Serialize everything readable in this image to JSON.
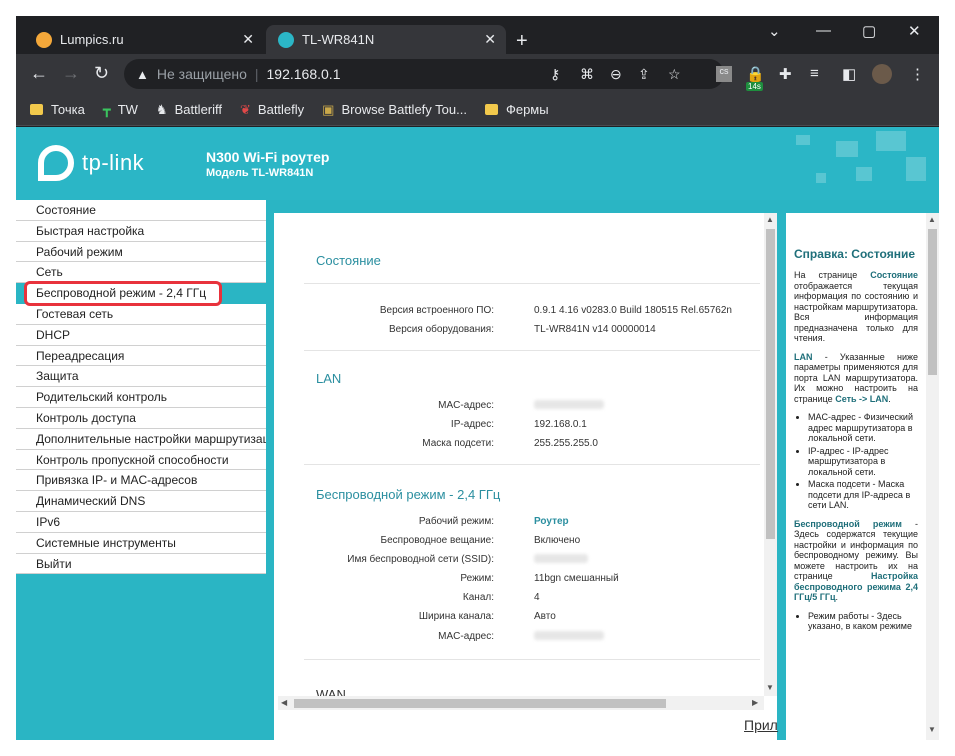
{
  "browser": {
    "tabs": [
      {
        "label": "Lumpics.ru",
        "close": "✕"
      },
      {
        "label": "TL-WR841N",
        "close": "✕"
      }
    ],
    "new_tab": "+",
    "window_controls": {
      "dropdown": "⌄",
      "minimize": "—",
      "maximize": "▢",
      "close": "✕"
    },
    "toolbar": {
      "back": "←",
      "forward": "→",
      "reload": "↻"
    },
    "omnibox": {
      "security_text": "Не защищено",
      "separator": "|",
      "url": "192.168.0.1"
    },
    "extension_badge": "14s",
    "bookmarks": [
      {
        "label": "Точка",
        "icon": "folder-icon"
      },
      {
        "label": "TW",
        "icon": "tw-icon"
      },
      {
        "label": "Battleriff",
        "icon": "battleriff-icon"
      },
      {
        "label": "Battlefly",
        "icon": "battlefly-icon"
      },
      {
        "label": "Browse Battlefy Tou...",
        "icon": "battlefy-icon"
      },
      {
        "label": "Фермы",
        "icon": "folder-icon"
      }
    ]
  },
  "router": {
    "logo_text": "tp-link",
    "product_title": "N300 Wi-Fi роутер",
    "product_model": "Модель TL-WR841N",
    "menu": [
      "Состояние",
      "Быстрая настройка",
      "Рабочий режим",
      "Сеть",
      "Беспроводной режим - 2,4 ГГц",
      "Гостевая сеть",
      "DHCP",
      "Переадресация",
      "Защита",
      "Родительский контроль",
      "Контроль доступа",
      "Дополнительные настройки маршрутизации",
      "Контроль пропускной способности",
      "Привязка IP- и MAC-адресов",
      "Динамический DNS",
      "IPv6",
      "Системные инструменты",
      "Выйти"
    ],
    "status": {
      "title": "Состояние",
      "firmware_label": "Версия встроенного ПО:",
      "firmware_value": "0.9.1 4.16 v0283.0 Build 180515 Rel.65762n",
      "hardware_label": "Версия оборудования:",
      "hardware_value": "TL-WR841N v14 00000014"
    },
    "lan": {
      "title": "LAN",
      "mac_label": "MAC-адрес:",
      "ip_label": "IP-адрес:",
      "ip_value": "192.168.0.1",
      "mask_label": "Маска подсети:",
      "mask_value": "255.255.255.0"
    },
    "wireless": {
      "title": "Беспроводной режим - 2,4 ГГц",
      "mode_label": "Рабочий режим:",
      "mode_value": "Роутер",
      "broadcast_label": "Беспроводное вещание:",
      "broadcast_value": "Включено",
      "ssid_label": "Имя беспроводной сети (SSID):",
      "netmode_label": "Режим:",
      "netmode_value": "11bgn смешанный",
      "channel_label": "Канал:",
      "channel_value": "4",
      "width_label": "Ширина канала:",
      "width_value": "Авто",
      "mac_label": "MAC-адрес:"
    },
    "wan": {
      "title": "WAN"
    },
    "bottom_link": "Прил",
    "help": {
      "title": "Справка: Состояние",
      "p1_a": "На странице ",
      "p1_link": "Состояние",
      "p1_b": " отображается текущая информация по состоянию и настройкам маршрутизатора. Вся информация предназначена только для чтения.",
      "p2_link": "LAN",
      "p2_a": " - Указанные ниже параметры применяются для порта LAN маршрутизатора. Их можно настроить на странице ",
      "p2_link2": "Сеть -> LAN",
      "p2_b": ".",
      "li1": "MAC-адрес - Физический адрес маршрутизатора в локальной сети.",
      "li2": "IP-адрес - IP-адрес маршрутизатора в локальной сети.",
      "li3": "Маска подсети - Маска подсети для IP-адреса в сети LAN.",
      "p3_link": "Беспроводной режим",
      "p3_a": " - Здесь содержатся текущие настройки и информация по беспроводному режиму. Вы можете настроить их на странице ",
      "p3_link2": "Настройка беспроводного режима 2,4 ГГц/5 ГГц",
      "p3_b": ".",
      "li4": "Режим работы - Здесь указано, в каком режиме"
    }
  },
  "colors": {
    "accent": "#2bb6c6",
    "highlight": "#e8323c",
    "link": "#2b8fa0"
  }
}
